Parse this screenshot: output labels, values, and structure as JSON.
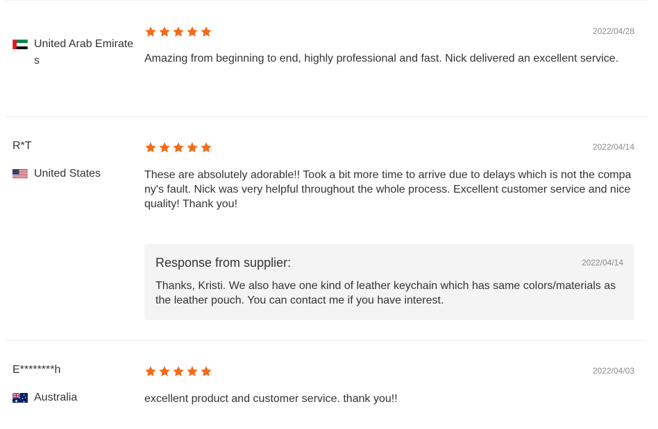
{
  "colors": {
    "star": "#f36b1c",
    "divider": "#ececec",
    "response_bg": "#f4f4f4"
  },
  "reviews": [
    {
      "buyer": "",
      "country": "United Arab Emirates",
      "flag_icon": "uae-flag-icon",
      "rating": 5,
      "date": "2022/04/28",
      "text": "Amazing from beginning to end, highly professional and fast. Nick delivered an excellent service."
    },
    {
      "buyer": "R*T",
      "country": "United States",
      "flag_icon": "us-flag-icon",
      "rating": 5,
      "date": "2022/04/14",
      "text": "These are absolutely adorable!! Took a bit more time to arrive due to delays which is not the company's fault. Nick was very helpful throughout the whole process. Excellent customer service and nice quality! Thank you!",
      "response": {
        "title": "Response from supplier:",
        "date": "2022/04/14",
        "text": "Thanks, Kristi. We also have one kind of leather keychain which has same colors/materials as the leather pouch. You can contact me if you have interest."
      }
    },
    {
      "buyer": "E********h",
      "country": "Australia",
      "flag_icon": "australia-flag-icon",
      "rating": 5,
      "date": "2022/04/03",
      "text": "excellent product and customer service. thank you!!"
    }
  ]
}
